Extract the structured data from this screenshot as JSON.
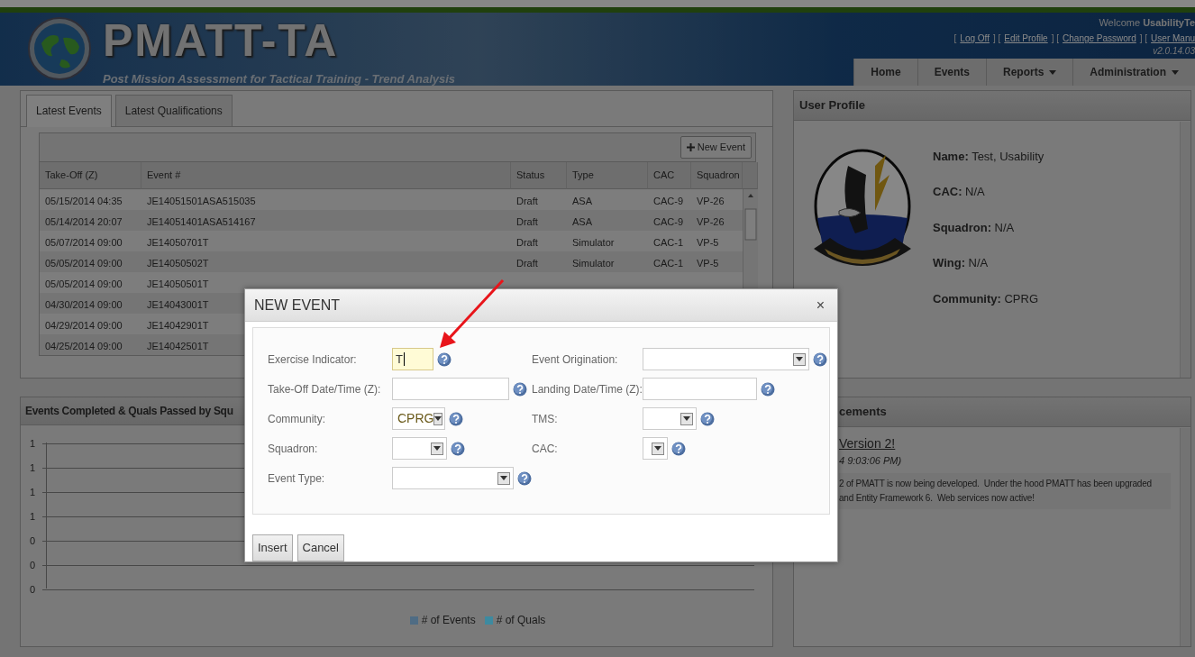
{
  "header": {
    "app_name": "PMATT-TA",
    "subtitle": "Post Mission Assessment for Tactical Training - Trend Analysis",
    "welcome": "Welcome **UsabilityTe**",
    "links": [
      {
        "kind": "text",
        "text": "["
      },
      {
        "kind": "link",
        "text": "Log Off"
      },
      {
        "kind": "text",
        "text": "] ["
      },
      {
        "kind": "link",
        "text": "Edit Profile"
      },
      {
        "kind": "text",
        "text": "] ["
      },
      {
        "kind": "link",
        "text": "Change Password"
      },
      {
        "kind": "text",
        "text": "] ["
      },
      {
        "kind": "link",
        "text": "User Manu"
      }
    ],
    "version": "v2.0.14.03"
  },
  "nav": [
    {
      "label": "Home",
      "has_menu": false
    },
    {
      "label": "Events",
      "has_menu": false
    },
    {
      "label": "Reports",
      "has_menu": true
    },
    {
      "label": "Administration",
      "has_menu": true
    }
  ],
  "events_panel": {
    "tabs": [
      {
        "label": "Latest Events",
        "selected": true
      },
      {
        "label": "Latest Qualifications",
        "selected": false
      }
    ],
    "new_event_button": "New Event",
    "table": {
      "columns": [
        "Take-Off (Z)",
        "Event #",
        "Status",
        "Type",
        "CAC",
        "Squadron"
      ],
      "rows": [
        [
          "05/15/2014 04:35",
          "JE14051501ASA515035",
          "Draft",
          "ASA",
          "CAC-9",
          "VP-26"
        ],
        [
          "05/14/2014 20:07",
          "JE14051401ASA514167",
          "Draft",
          "ASA",
          "CAC-9",
          "VP-26"
        ],
        [
          "05/07/2014 09:00",
          "JE14050701T",
          "Draft",
          "Simulator",
          "CAC-1",
          "VP-5"
        ],
        [
          "05/05/2014 09:00",
          "JE14050502T",
          "Draft",
          "Simulator",
          "CAC-1",
          "VP-5"
        ],
        [
          "05/05/2014 09:00",
          "JE14050501T"
        ],
        [
          "04/30/2014 09:00",
          "JE14043001T"
        ],
        [
          "04/29/2014 09:00",
          "JE14042901T"
        ],
        [
          "04/25/2014 09:00",
          "JE14042501T"
        ]
      ]
    }
  },
  "chart_panel": {
    "title": "Events Completed & Quals Passed by Squ",
    "y_labels": [
      "1",
      "1",
      "1",
      "1",
      "0",
      "0",
      "0"
    ],
    "legend": [
      {
        "label": "# of Events",
        "color": "#4f6c84"
      },
      {
        "label": "# of Quals",
        "color": "#3d8aa0"
      }
    ]
  },
  "profile_panel": {
    "title": "User Profile",
    "picture": {
      "kind": "picture"
    },
    "fields": [
      "**Name:** Test, Usability",
      "**CAC:** N/A",
      "**Squadron:** N/A",
      "**Wing:** N/A",
      "**Community:** CPRG"
    ]
  },
  "announcements_panel": {
    "title": "cements",
    "item_title": "Version 2!",
    "date": "4 9:03:06 PM)",
    "lines": [
      "2 of PMATT is now being developed.  Under the hood PMATT has been upgraded",
      "and Entity Framework 6.  Web services now active!"
    ]
  },
  "dialog": {
    "title": "NEW EVENT",
    "close": "×",
    "left_fields": [
      {
        "label": "Exercise Indicator:",
        "kind": "text",
        "value": "T",
        "focused": true
      },
      {
        "label": "Take-Off Date/Time (Z):",
        "kind": "text",
        "focused": false
      },
      {
        "label": "Community:",
        "kind": "select",
        "value": "CPRG",
        "focused": false
      },
      {
        "label": "Squadron:",
        "kind": "select",
        "focused": false
      },
      {
        "label": "Event Type:",
        "kind": "select",
        "focused": false
      }
    ],
    "right_fields": [
      {
        "label": "Event Origination:",
        "kind": "select",
        "focused": false
      },
      {
        "label": "Landing Date/Time (Z):",
        "kind": "text",
        "focused": false
      },
      {
        "label": "TMS:",
        "kind": "select",
        "focused": false
      },
      {
        "label": "CAC:",
        "kind": "select",
        "focused": false
      }
    ],
    "buttons": [
      "Insert",
      "Cancel"
    ]
  }
}
